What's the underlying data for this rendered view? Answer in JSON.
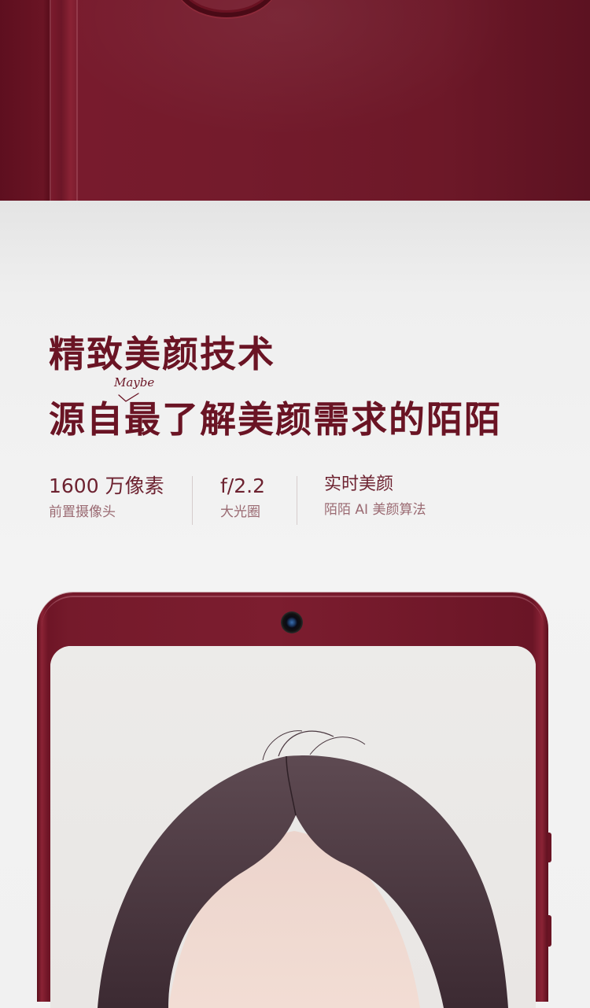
{
  "headline": {
    "line1": "精致美颜技术",
    "line2": "源自最了解美颜需求的陌陌",
    "annotation": "Maybe"
  },
  "specs": [
    {
      "value": "1600 万像素",
      "label": "前置摄像头"
    },
    {
      "value": "f/2.2",
      "label": "大光圈"
    },
    {
      "value": "实时美颜",
      "label": "陌陌 AI 美颜算法"
    }
  ],
  "colors": {
    "accent": "#6a1424",
    "phone_body": "#7c1d2f",
    "background": "#f1f1f1",
    "subtitle": "#9a6a72"
  },
  "icons": {
    "front_camera": "front-camera-icon"
  }
}
